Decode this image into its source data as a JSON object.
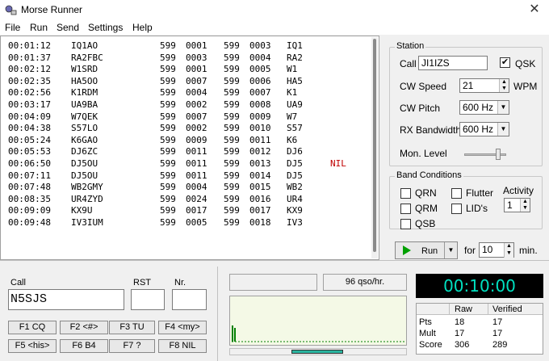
{
  "window": {
    "title": "Morse Runner",
    "close_glyph": "✕"
  },
  "menu": [
    "File",
    "Run",
    "Send",
    "Settings",
    "Help"
  ],
  "log": {
    "rows": [
      {
        "time": "00:01:12",
        "call": "IQ1AO",
        "rst_sent": "599",
        "nr_sent": "0001",
        "rst_rcvd": "599",
        "nr_rcvd": "0003",
        "mult": "IQ1",
        "check": ""
      },
      {
        "time": "00:01:37",
        "call": "RA2FBC",
        "rst_sent": "599",
        "nr_sent": "0003",
        "rst_rcvd": "599",
        "nr_rcvd": "0004",
        "mult": "RA2",
        "check": ""
      },
      {
        "time": "00:02:12",
        "call": "W1SRD",
        "rst_sent": "599",
        "nr_sent": "0001",
        "rst_rcvd": "599",
        "nr_rcvd": "0005",
        "mult": "W1",
        "check": ""
      },
      {
        "time": "00:02:35",
        "call": "HA5OO",
        "rst_sent": "599",
        "nr_sent": "0007",
        "rst_rcvd": "599",
        "nr_rcvd": "0006",
        "mult": "HA5",
        "check": ""
      },
      {
        "time": "00:02:56",
        "call": "K1RDM",
        "rst_sent": "599",
        "nr_sent": "0004",
        "rst_rcvd": "599",
        "nr_rcvd": "0007",
        "mult": "K1",
        "check": ""
      },
      {
        "time": "00:03:17",
        "call": "UA9BA",
        "rst_sent": "599",
        "nr_sent": "0002",
        "rst_rcvd": "599",
        "nr_rcvd": "0008",
        "mult": "UA9",
        "check": ""
      },
      {
        "time": "00:04:09",
        "call": "W7QEK",
        "rst_sent": "599",
        "nr_sent": "0007",
        "rst_rcvd": "599",
        "nr_rcvd": "0009",
        "mult": "W7",
        "check": ""
      },
      {
        "time": "00:04:38",
        "call": "S57LO",
        "rst_sent": "599",
        "nr_sent": "0002",
        "rst_rcvd": "599",
        "nr_rcvd": "0010",
        "mult": "S57",
        "check": ""
      },
      {
        "time": "00:05:24",
        "call": "K6GAO",
        "rst_sent": "599",
        "nr_sent": "0009",
        "rst_rcvd": "599",
        "nr_rcvd": "0011",
        "mult": "K6",
        "check": ""
      },
      {
        "time": "00:05:53",
        "call": "DJ6ZC",
        "rst_sent": "599",
        "nr_sent": "0011",
        "rst_rcvd": "599",
        "nr_rcvd": "0012",
        "mult": "DJ6",
        "check": ""
      },
      {
        "time": "00:06:50",
        "call": "DJ5OU",
        "rst_sent": "599",
        "nr_sent": "0011",
        "rst_rcvd": "599",
        "nr_rcvd": "0013",
        "mult": "DJ5",
        "check": "NIL"
      },
      {
        "time": "00:07:11",
        "call": "DJ5OU",
        "rst_sent": "599",
        "nr_sent": "0011",
        "rst_rcvd": "599",
        "nr_rcvd": "0014",
        "mult": "DJ5",
        "check": ""
      },
      {
        "time": "00:07:48",
        "call": "WB2GMY",
        "rst_sent": "599",
        "nr_sent": "0004",
        "rst_rcvd": "599",
        "nr_rcvd": "0015",
        "mult": "WB2",
        "check": ""
      },
      {
        "time": "00:08:35",
        "call": "UR4ZYD",
        "rst_sent": "599",
        "nr_sent": "0024",
        "rst_rcvd": "599",
        "nr_rcvd": "0016",
        "mult": "UR4",
        "check": ""
      },
      {
        "time": "00:09:09",
        "call": "KX9U",
        "rst_sent": "599",
        "nr_sent": "0017",
        "rst_rcvd": "599",
        "nr_rcvd": "0017",
        "mult": "KX9",
        "check": ""
      },
      {
        "time": "00:09:48",
        "call": "IV3IUM",
        "rst_sent": "599",
        "nr_sent": "0005",
        "rst_rcvd": "599",
        "nr_rcvd": "0018",
        "mult": "IV3",
        "check": ""
      }
    ]
  },
  "station": {
    "group_title": "Station",
    "call_label": "Call",
    "call_value": "JI1IZS",
    "qsk_label": "QSK",
    "qsk_checked": true,
    "cw_speed_label": "CW Speed",
    "cw_speed_value": "21",
    "wpm_label": "WPM",
    "cw_pitch_label": "CW Pitch",
    "cw_pitch_value": "600 Hz",
    "rx_bw_label": "RX Bandwidth",
    "rx_bw_value": "600 Hz",
    "mon_level_label": "Mon. Level",
    "mon_level_fraction": 0.8
  },
  "band_conditions": {
    "group_title": "Band Conditions",
    "qrn_label": "QRN",
    "qrm_label": "QRM",
    "qsb_label": "QSB",
    "flutter_label": "Flutter",
    "lids_label": "LID's",
    "activity_label": "Activity",
    "activity_value": "1"
  },
  "run_controls": {
    "run_label": "Run",
    "for_label": "for",
    "minutes_value": "10",
    "min_label": "min."
  },
  "entry": {
    "call_label": "Call",
    "call_value": "N5SJS",
    "rst_label": "RST",
    "rst_value": "",
    "nr_label": "Nr.",
    "nr_value": ""
  },
  "function_keys": [
    "F1 CQ",
    "F2 <#>",
    "F3 TU",
    "F4 <my>",
    "F5 <his>",
    "F6 B4",
    "F7 ?",
    "F8 NIL"
  ],
  "rate": {
    "text": "96 qso/hr."
  },
  "timer": {
    "text": "00:10:00",
    "color": "#00e0c0"
  },
  "score": {
    "headers": [
      "",
      "Raw",
      "Verified"
    ],
    "rows": [
      {
        "label": "Pts",
        "raw": "18",
        "verified": "17"
      },
      {
        "label": "Mult",
        "raw": "17",
        "verified": "17"
      },
      {
        "label": "Score",
        "raw": "306",
        "verified": "289"
      }
    ]
  },
  "colors": {
    "nil": "#c00000",
    "run_arrow": "#00a000",
    "bandmap_bg": "#f4f9e6",
    "signal": "#008000"
  }
}
